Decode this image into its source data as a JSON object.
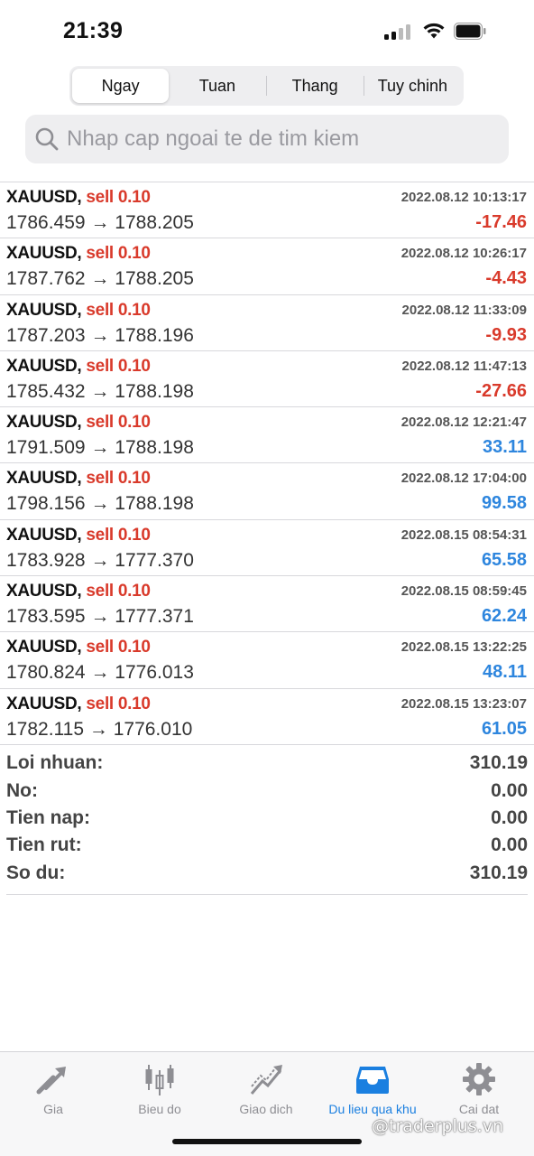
{
  "status_bar": {
    "time": "21:39"
  },
  "segments": [
    {
      "label": "Ngay",
      "active": true
    },
    {
      "label": "Tuan",
      "active": false
    },
    {
      "label": "Thang",
      "active": false
    },
    {
      "label": "Tuy chinh",
      "active": false
    }
  ],
  "search": {
    "placeholder": "Nhap cap ngoai te de tim kiem",
    "value": ""
  },
  "deals": [
    {
      "symbol": "XAUUSD,",
      "side": "sell 0.10",
      "open": "1786.459",
      "arrow": "→",
      "close": "1788.205",
      "time": "2022.08.12 10:13:17",
      "profit": "-17.46"
    },
    {
      "symbol": "XAUUSD,",
      "side": "sell 0.10",
      "open": "1787.762",
      "arrow": "→",
      "close": "1788.205",
      "time": "2022.08.12 10:26:17",
      "profit": "-4.43"
    },
    {
      "symbol": "XAUUSD,",
      "side": "sell 0.10",
      "open": "1787.203",
      "arrow": "→",
      "close": "1788.196",
      "time": "2022.08.12 11:33:09",
      "profit": "-9.93"
    },
    {
      "symbol": "XAUUSD,",
      "side": "sell 0.10",
      "open": "1785.432",
      "arrow": "→",
      "close": "1788.198",
      "time": "2022.08.12 11:47:13",
      "profit": "-27.66"
    },
    {
      "symbol": "XAUUSD,",
      "side": "sell 0.10",
      "open": "1791.509",
      "arrow": "→",
      "close": "1788.198",
      "time": "2022.08.12 12:21:47",
      "profit": "33.11"
    },
    {
      "symbol": "XAUUSD,",
      "side": "sell 0.10",
      "open": "1798.156",
      "arrow": "→",
      "close": "1788.198",
      "time": "2022.08.12 17:04:00",
      "profit": "99.58"
    },
    {
      "symbol": "XAUUSD,",
      "side": "sell 0.10",
      "open": "1783.928",
      "arrow": "→",
      "close": "1777.370",
      "time": "2022.08.15 08:54:31",
      "profit": "65.58"
    },
    {
      "symbol": "XAUUSD,",
      "side": "sell 0.10",
      "open": "1783.595",
      "arrow": "→",
      "close": "1777.371",
      "time": "2022.08.15 08:59:45",
      "profit": "62.24"
    },
    {
      "symbol": "XAUUSD,",
      "side": "sell 0.10",
      "open": "1780.824",
      "arrow": "→",
      "close": "1776.013",
      "time": "2022.08.15 13:22:25",
      "profit": "48.11"
    },
    {
      "symbol": "XAUUSD,",
      "side": "sell 0.10",
      "open": "1782.115",
      "arrow": "→",
      "close": "1776.010",
      "time": "2022.08.15 13:23:07",
      "profit": "61.05"
    }
  ],
  "summary": [
    {
      "label": "Loi nhuan:",
      "value": "310.19"
    },
    {
      "label": "No:",
      "value": "0.00"
    },
    {
      "label": "Tien nap:",
      "value": "0.00"
    },
    {
      "label": "Tien rut:",
      "value": "0.00"
    },
    {
      "label": "So du:",
      "value": "310.19"
    }
  ],
  "tabbar": [
    {
      "label": "Gia",
      "icon": "quotes-arrows-icon",
      "active": false
    },
    {
      "label": "Bieu do",
      "icon": "candlestick-chart-icon",
      "active": false
    },
    {
      "label": "Giao dich",
      "icon": "trade-chart-icon",
      "active": false
    },
    {
      "label": "Du lieu qua khu",
      "icon": "history-inbox-icon",
      "active": true
    },
    {
      "label": "Cai dat",
      "icon": "gear-icon",
      "active": false
    }
  ],
  "watermark": "@traderplus.vn",
  "colors": {
    "loss": "#d93a2b",
    "gain": "#2e86de",
    "active_tab": "#1a7fe0",
    "inactive_tab": "#8e8e93"
  }
}
